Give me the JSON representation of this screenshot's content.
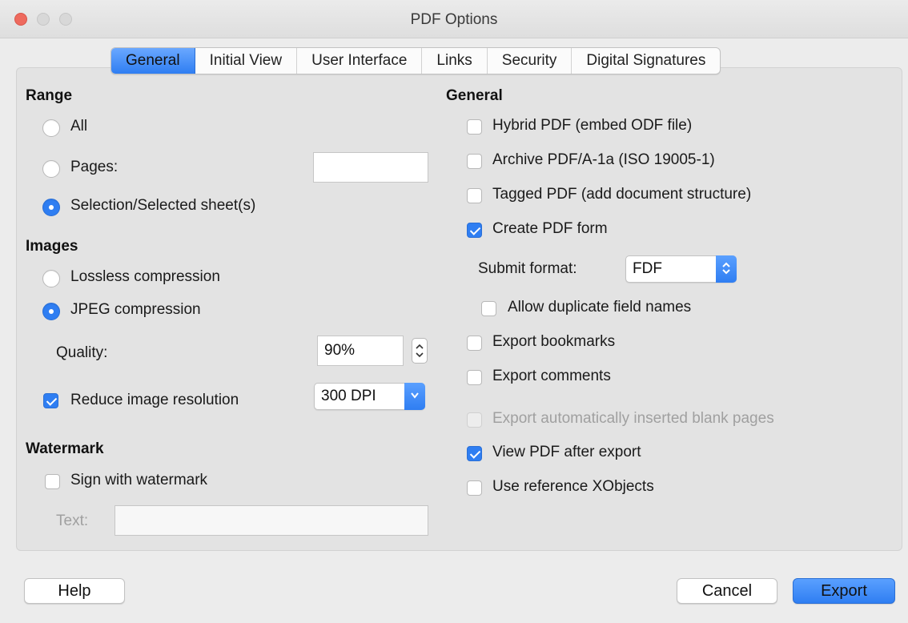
{
  "window": {
    "title": "PDF Options"
  },
  "tabs": [
    {
      "label": "General",
      "active": true
    },
    {
      "label": "Initial View",
      "active": false
    },
    {
      "label": "User Interface",
      "active": false
    },
    {
      "label": "Links",
      "active": false
    },
    {
      "label": "Security",
      "active": false
    },
    {
      "label": "Digital Signatures",
      "active": false
    }
  ],
  "range": {
    "title": "Range",
    "all": "All",
    "pages": "Pages:",
    "pages_value": "",
    "selection": "Selection/Selected sheet(s)",
    "selected": "selection"
  },
  "images": {
    "title": "Images",
    "lossless": "Lossless compression",
    "jpeg": "JPEG compression",
    "selected": "jpeg",
    "quality_label": "Quality:",
    "quality_value": "90%",
    "reduce_label": "Reduce image resolution",
    "reduce_checked": true,
    "resolution_value": "300 DPI"
  },
  "watermark": {
    "title": "Watermark",
    "sign_label": "Sign with watermark",
    "sign_checked": false,
    "text_label": "Text:",
    "text_value": ""
  },
  "general": {
    "title": "General",
    "hybrid": {
      "label": "Hybrid PDF (embed ODF file)",
      "checked": false
    },
    "archive": {
      "label": "Archive PDF/A-1a (ISO 19005-1)",
      "checked": false
    },
    "tagged": {
      "label": "Tagged PDF (add document structure)",
      "checked": false
    },
    "form": {
      "label": "Create PDF form",
      "checked": true
    },
    "submit_label": "Submit format:",
    "submit_value": "FDF",
    "duplicate": {
      "label": "Allow duplicate field names",
      "checked": false
    },
    "bookmarks": {
      "label": "Export bookmarks",
      "checked": false
    },
    "comments": {
      "label": "Export comments",
      "checked": false
    },
    "blank": {
      "label": "Export automatically inserted blank pages",
      "checked": false,
      "disabled": true
    },
    "view": {
      "label": "View PDF after export",
      "checked": true
    },
    "xobjects": {
      "label": "Use reference XObjects",
      "checked": false
    }
  },
  "buttons": {
    "help": "Help",
    "cancel": "Cancel",
    "export": "Export"
  },
  "colors": {
    "accent": "#2f7ef2",
    "close": "#ee6a5e"
  }
}
